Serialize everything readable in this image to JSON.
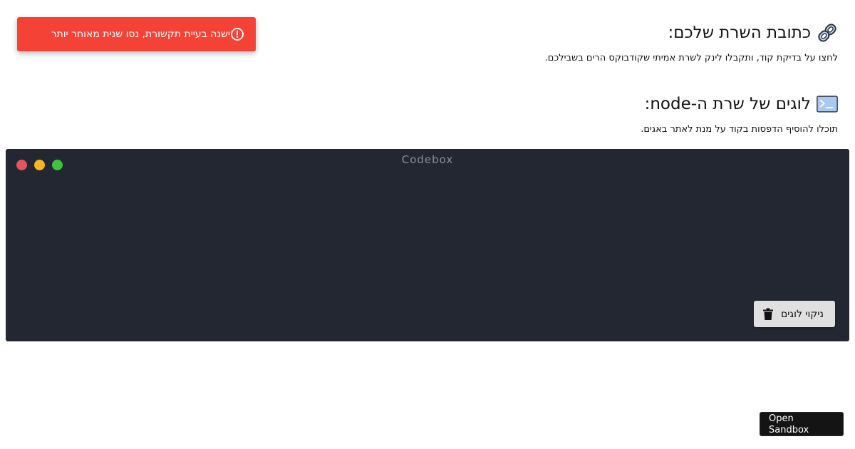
{
  "toast": {
    "message": "ישנה בעיית תקשורת, נסו שנית מאוחר יותר",
    "icon": "alert-circle-icon",
    "color": "#f44336"
  },
  "server_url": {
    "title": "כתובת השרת שלכם:",
    "description": "לחצו על בדיקת קוד, ותקבלו לינק לשרת אמיתי שקודבוקס הרים בשבילכם.",
    "icon": "link-icon"
  },
  "node_logs": {
    "title": "לוגים של שרת ה-node:",
    "description": "תוכלו להוסיף הדפסות בקוד על מנת לאתר באגים.",
    "icon": "terminal-icon"
  },
  "codebox": {
    "title": "Codebox",
    "background": "#232731",
    "clear_button": {
      "label": "ניקוי לוגים",
      "icon": "trash-icon"
    }
  },
  "sandbox_button": {
    "label": "Open Sandbox"
  }
}
